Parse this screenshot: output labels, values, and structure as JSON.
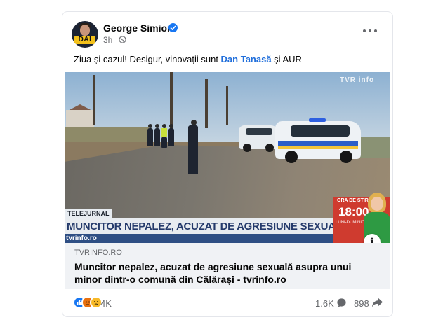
{
  "post": {
    "author": "George Simion",
    "verified": true,
    "time": "3h",
    "privacy_icon": "globe-icon",
    "avatar_badge": "DAI",
    "text_before": "Ziua și cazul! Desigur, vinovații sunt ",
    "mention": "Dan Tanasă",
    "text_middle": " și ",
    "text_after": "AUR",
    "mention_color": "#216fdb"
  },
  "media": {
    "tv_logo": "TVR info",
    "tag": "TELEJURNAL",
    "headline": "MUNCITOR NEPALEZ, ACUZAT DE AGRESIUNE SEXUALĂ",
    "ticker_logo": "tvrinfo.ro",
    "ora_label": "ORA DE ȘTIRI",
    "ora_time": "18:00",
    "ora_days": "LUNI-DUMINICĂ"
  },
  "link": {
    "domain": "TVRINFO.RO",
    "title": "Muncitor nepalez, acuzat de agresiune sexuală asupra unui minor dintr-o comună din Călărași - tvrinfo.ro"
  },
  "footer": {
    "reactions": [
      "like-icon",
      "angry-icon",
      "sad-icon"
    ],
    "reaction_count": "4K",
    "comment_count": "1.6K",
    "share_count": "898"
  },
  "colors": {
    "accent": "#1877f2",
    "secondary_text": "#65676b",
    "link_bg": "#f0f2f5"
  }
}
